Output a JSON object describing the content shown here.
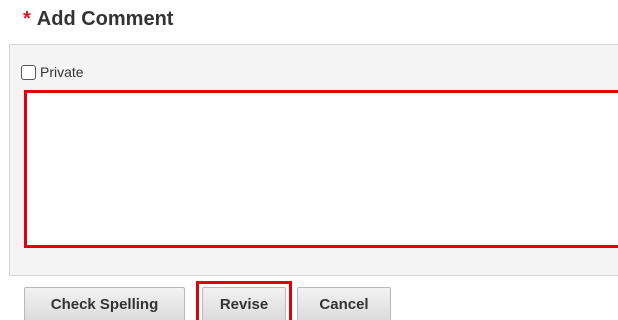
{
  "section": {
    "required_marker": "*",
    "title": "Add Comment"
  },
  "private_checkbox": {
    "label": "Private",
    "checked": false
  },
  "comment": {
    "value": "",
    "placeholder": ""
  },
  "buttons": {
    "check_spelling": "Check Spelling",
    "revise": "Revise",
    "cancel": "Cancel"
  },
  "colors": {
    "required": "#d71920",
    "highlight": "#e0000b"
  }
}
